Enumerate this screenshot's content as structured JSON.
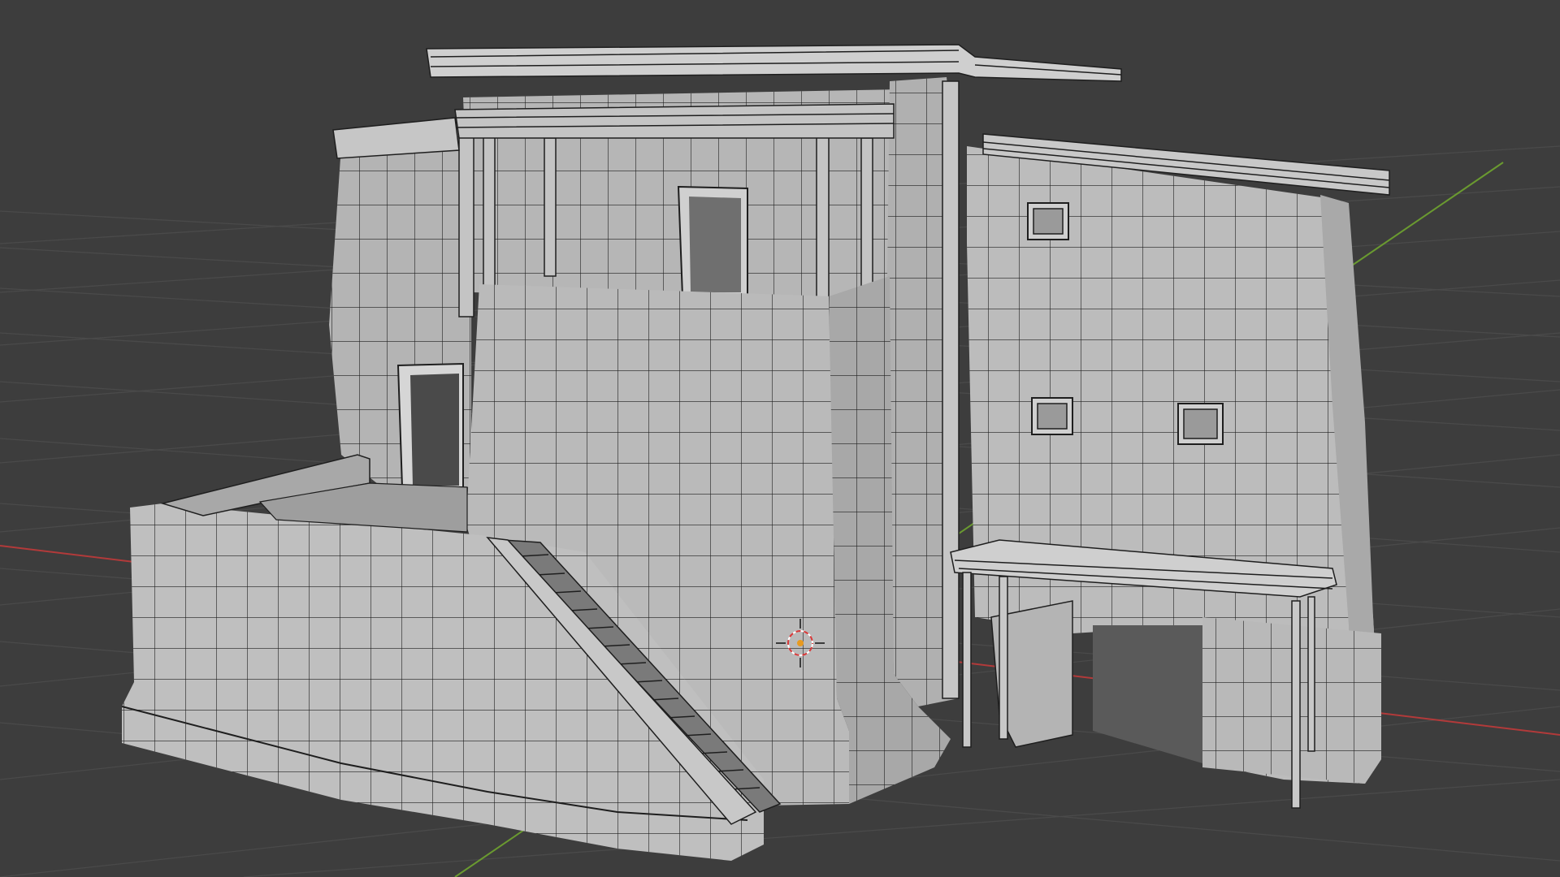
{
  "viewport": {
    "background": "#3d3d3d",
    "grid_color": "#4a4a4a",
    "x_axis_color": "#b23a3a",
    "y_axis_color": "#6a9a30"
  },
  "model": {
    "face_color": "#b9b9b9",
    "face_shade": "#a6a6a6",
    "face_dark": "#8a8a8a",
    "wire_color": "#1e1e1e"
  },
  "icons": {
    "cursor": "3d-cursor-icon"
  }
}
